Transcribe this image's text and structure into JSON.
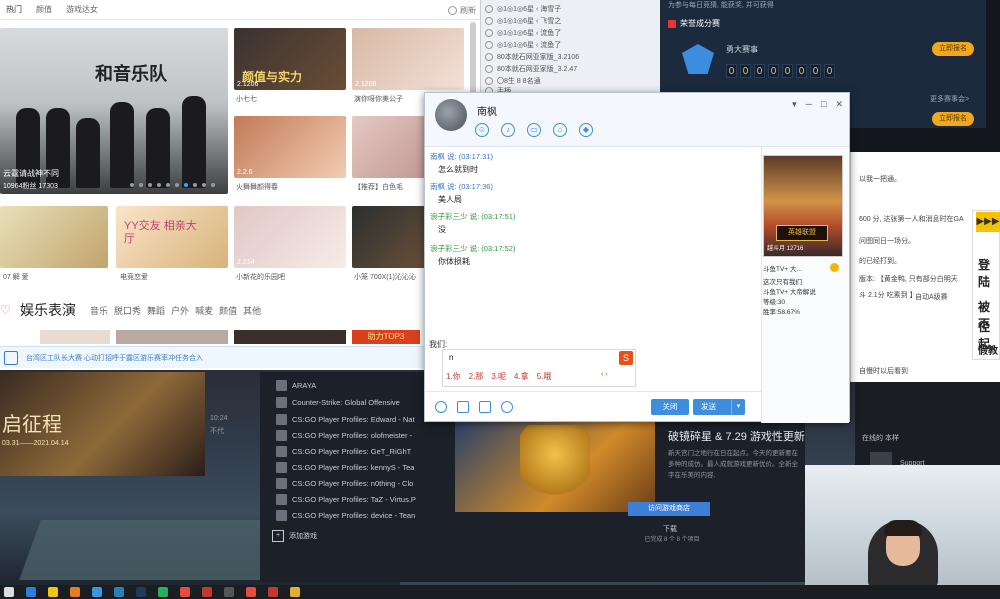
{
  "web": {
    "tabs": [
      "热门",
      "颜值",
      "游戏达女"
    ],
    "refresh_label": "刷新",
    "big": {
      "title": "和音乐队",
      "caption": "云霆请战神不同",
      "count": "10964粉丝 17303"
    },
    "thumbs": [
      {
        "label": "颜值与实力",
        "count": "2.1206",
        "cap": "小七七"
      },
      {
        "label": "",
        "count": "2.1208",
        "cap": "演你呀你美公子"
      },
      {
        "label": "",
        "count": "2.2.6",
        "cap": "火舞舞颜得春"
      },
      {
        "label": "",
        "count": "",
        "cap": "【推荐】白色毛"
      },
      {
        "label": "",
        "count": "",
        "cap": "07 解 爱"
      },
      {
        "label": "YY交友 相亲大厅",
        "count": "",
        "cap": "电竞恋爱"
      },
      {
        "label": "",
        "count": "2.214",
        "cap": "小新花的乐园吧"
      },
      {
        "label": "",
        "count": "",
        "cap": "小笼 700X(1)沁沁沁"
      }
    ],
    "section_title": "娱乐表演",
    "categories": [
      "音乐",
      "脱口秀",
      "舞蹈",
      "户外",
      "喊麦",
      "颜值",
      "其他"
    ],
    "power_label": "助力TOP3",
    "ticker": "台湾区工队长大赛 心动打招呼于露区游乐赛率冲任务合入"
  },
  "list": {
    "rows": [
      "◎1◎1◎6星 ‹ 海雪子",
      "◎1◎1◎6星 ‹ 飞雪之",
      "◎1◎1◎6星 ‹ 流鱼了",
      "◎1◎1◎6星 ‹ 流鱼了",
      "80本就石网亚家版_3.2106",
      "80本就石网亚家版_3.2.47",
      "〇8生 8 8名通",
      "手柄"
    ]
  },
  "dark": {
    "top": "为参与每日竞猜, 能获奖, 并可获得",
    "head": "荣誉成分赛",
    "name": "勇大赛事",
    "digits": [
      "0",
      "0",
      "0",
      "0",
      "0",
      "0",
      "0",
      "0"
    ],
    "btn1": "立即报名",
    "btn2": "立即报名",
    "more": "更多赛事会>"
  },
  "chat": {
    "name": "南枫",
    "messages": [
      {
        "from": "南枫 说: (03:17:31)",
        "text": "怎么就到时"
      },
      {
        "from": "南枫 说: (03:17:36)",
        "text": "美人局"
      },
      {
        "from": "浪子彩三少 说: (03:17:51)",
        "text": "没"
      },
      {
        "from": "浪子彩三少 说: (03:17:52)",
        "text": "你体损耗"
      }
    ],
    "input_label": "我们:",
    "input_value": "n",
    "ime": [
      "1.你",
      "2.那",
      "3.呢",
      "4.拿",
      "5.哦"
    ],
    "ime_nav": "‹ ›",
    "close_label": "关闭",
    "send_label": "发送",
    "card": {
      "gold": "英雄联盟",
      "caption": "越斗月 12716",
      "lines": [
        "斗鱼TV+ 大...",
        "这次只有我们",
        "斗鱼TV+ 大帝解说",
        "等级:30",
        "胜率:58.67%"
      ]
    }
  },
  "article": {
    "lines": [
      "以我一把通。",
      "",
      "600 分, 达张第一人和消息时在GA",
      "",
      "问图同日一场分。",
      "",
      "的已经打到。",
      "",
      "版本: 【黄金鸭, 只有部分白明天",
      "斗 2.1分 吃素到 】",
      "",
      "自动A级赛",
      "",
      "",
      "",
      "",
      "",
      "",
      "",
      "",
      "",
      "",
      "自慢时以后看到"
    ],
    "ytab": "▶▶▶",
    "ytxt": [
      "登陆",
      "被不",
      "径起",
      "假教"
    ]
  },
  "library": {
    "games": [
      "ARAYA",
      "Counter-Strike: Global Offensive",
      "CS:GO Player Profiles: Edward - Nat",
      "CS:GO Player Profiles: olofmeister - ",
      "CS:GO Player Profiles: GeT_RiGhT",
      "CS:GO Player Profiles: kennyS - Tea",
      "CS:GO Player Profiles: n0thing - Clo",
      "CS:GO Player Profiles: TaZ - Virtus.P",
      "CS:GO Player Profiles: device - Tean"
    ],
    "add_label": "添加游戏",
    "news_title": "破镜碎星 & 7.29 游戏性更新",
    "news_body": "新天宫门之地行在日在起点。今天的更新要在多种的成仿。最人成就游戏更新优价。全新全字在乐美的内容,",
    "store_label": "访问游戏商店",
    "download_label": "下载",
    "download_sub": "已完成 8 个 8 个项目"
  },
  "event": {
    "title": "启征程",
    "date": "03.31——2021.04.14",
    "side": [
      "10:24",
      "不代"
    ]
  },
  "rchat": {
    "l1": "在线的 本样",
    "l2": "Support",
    "btn": "在线的 本样"
  },
  "colors": {
    "accent": "#3e8ee0",
    "gold": "#f0a81e"
  }
}
